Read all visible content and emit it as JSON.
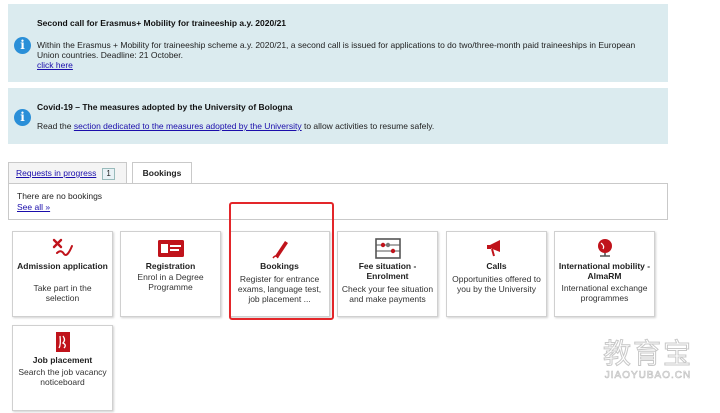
{
  "notices": [
    {
      "title": "Second call for Erasmus+ Mobility for traineeship a.y. 2020/21",
      "body": "Within the Erasmus + Mobility for traineeship scheme a.y. 2020/21, a second call is issued for applications to do two/three-month paid traineeships in European Union countries. Deadline: 21 October.",
      "link": "click here"
    },
    {
      "title": "Covid-19 – The measures adopted by the University of Bologna",
      "body_before": "Read the ",
      "link": "section dedicated to the measures adopted by the University",
      "body_after": " to allow activities to resume safely."
    }
  ],
  "tabs": {
    "requests_label": "Requests in progress",
    "requests_count": "1",
    "bookings_label": "Bookings"
  },
  "bookings_panel": {
    "empty_text": "There are no bookings",
    "see_all": "See all »"
  },
  "cards": {
    "admission": {
      "title": "Admission application",
      "desc": "Take part in the selection",
      "icon": "signature-check-icon"
    },
    "registration": {
      "title": "Registration",
      "desc": "Enrol in a Degree Programme",
      "icon": "id-card-icon"
    },
    "bookings": {
      "title": "Bookings",
      "desc": "Register for entrance exams, language test, job placement ...",
      "icon": "pen-icon"
    },
    "fees": {
      "title": "Fee situation - Enrolment",
      "desc": "Check your fee situation and make payments",
      "icon": "abacus-icon"
    },
    "calls": {
      "title": "Calls",
      "desc": "Opportunities offered to you by the University",
      "icon": "megaphone-icon"
    },
    "mobility": {
      "title": "International mobility - AlmaRM",
      "desc": "International exchange programmes",
      "icon": "globe-icon"
    },
    "job": {
      "title": "Job placement",
      "desc": "Search the job vacancy noticeboard",
      "icon": "job-logo-icon"
    }
  },
  "watermark": {
    "text": "教育宝",
    "url": "JIAOYUBAO.CN"
  },
  "colors": {
    "notice_bg": "#dbebef",
    "info_icon": "#2a8fd8",
    "accent_red": "#c0131b",
    "highlight": "#e3262a",
    "link": "#1a0dab"
  }
}
